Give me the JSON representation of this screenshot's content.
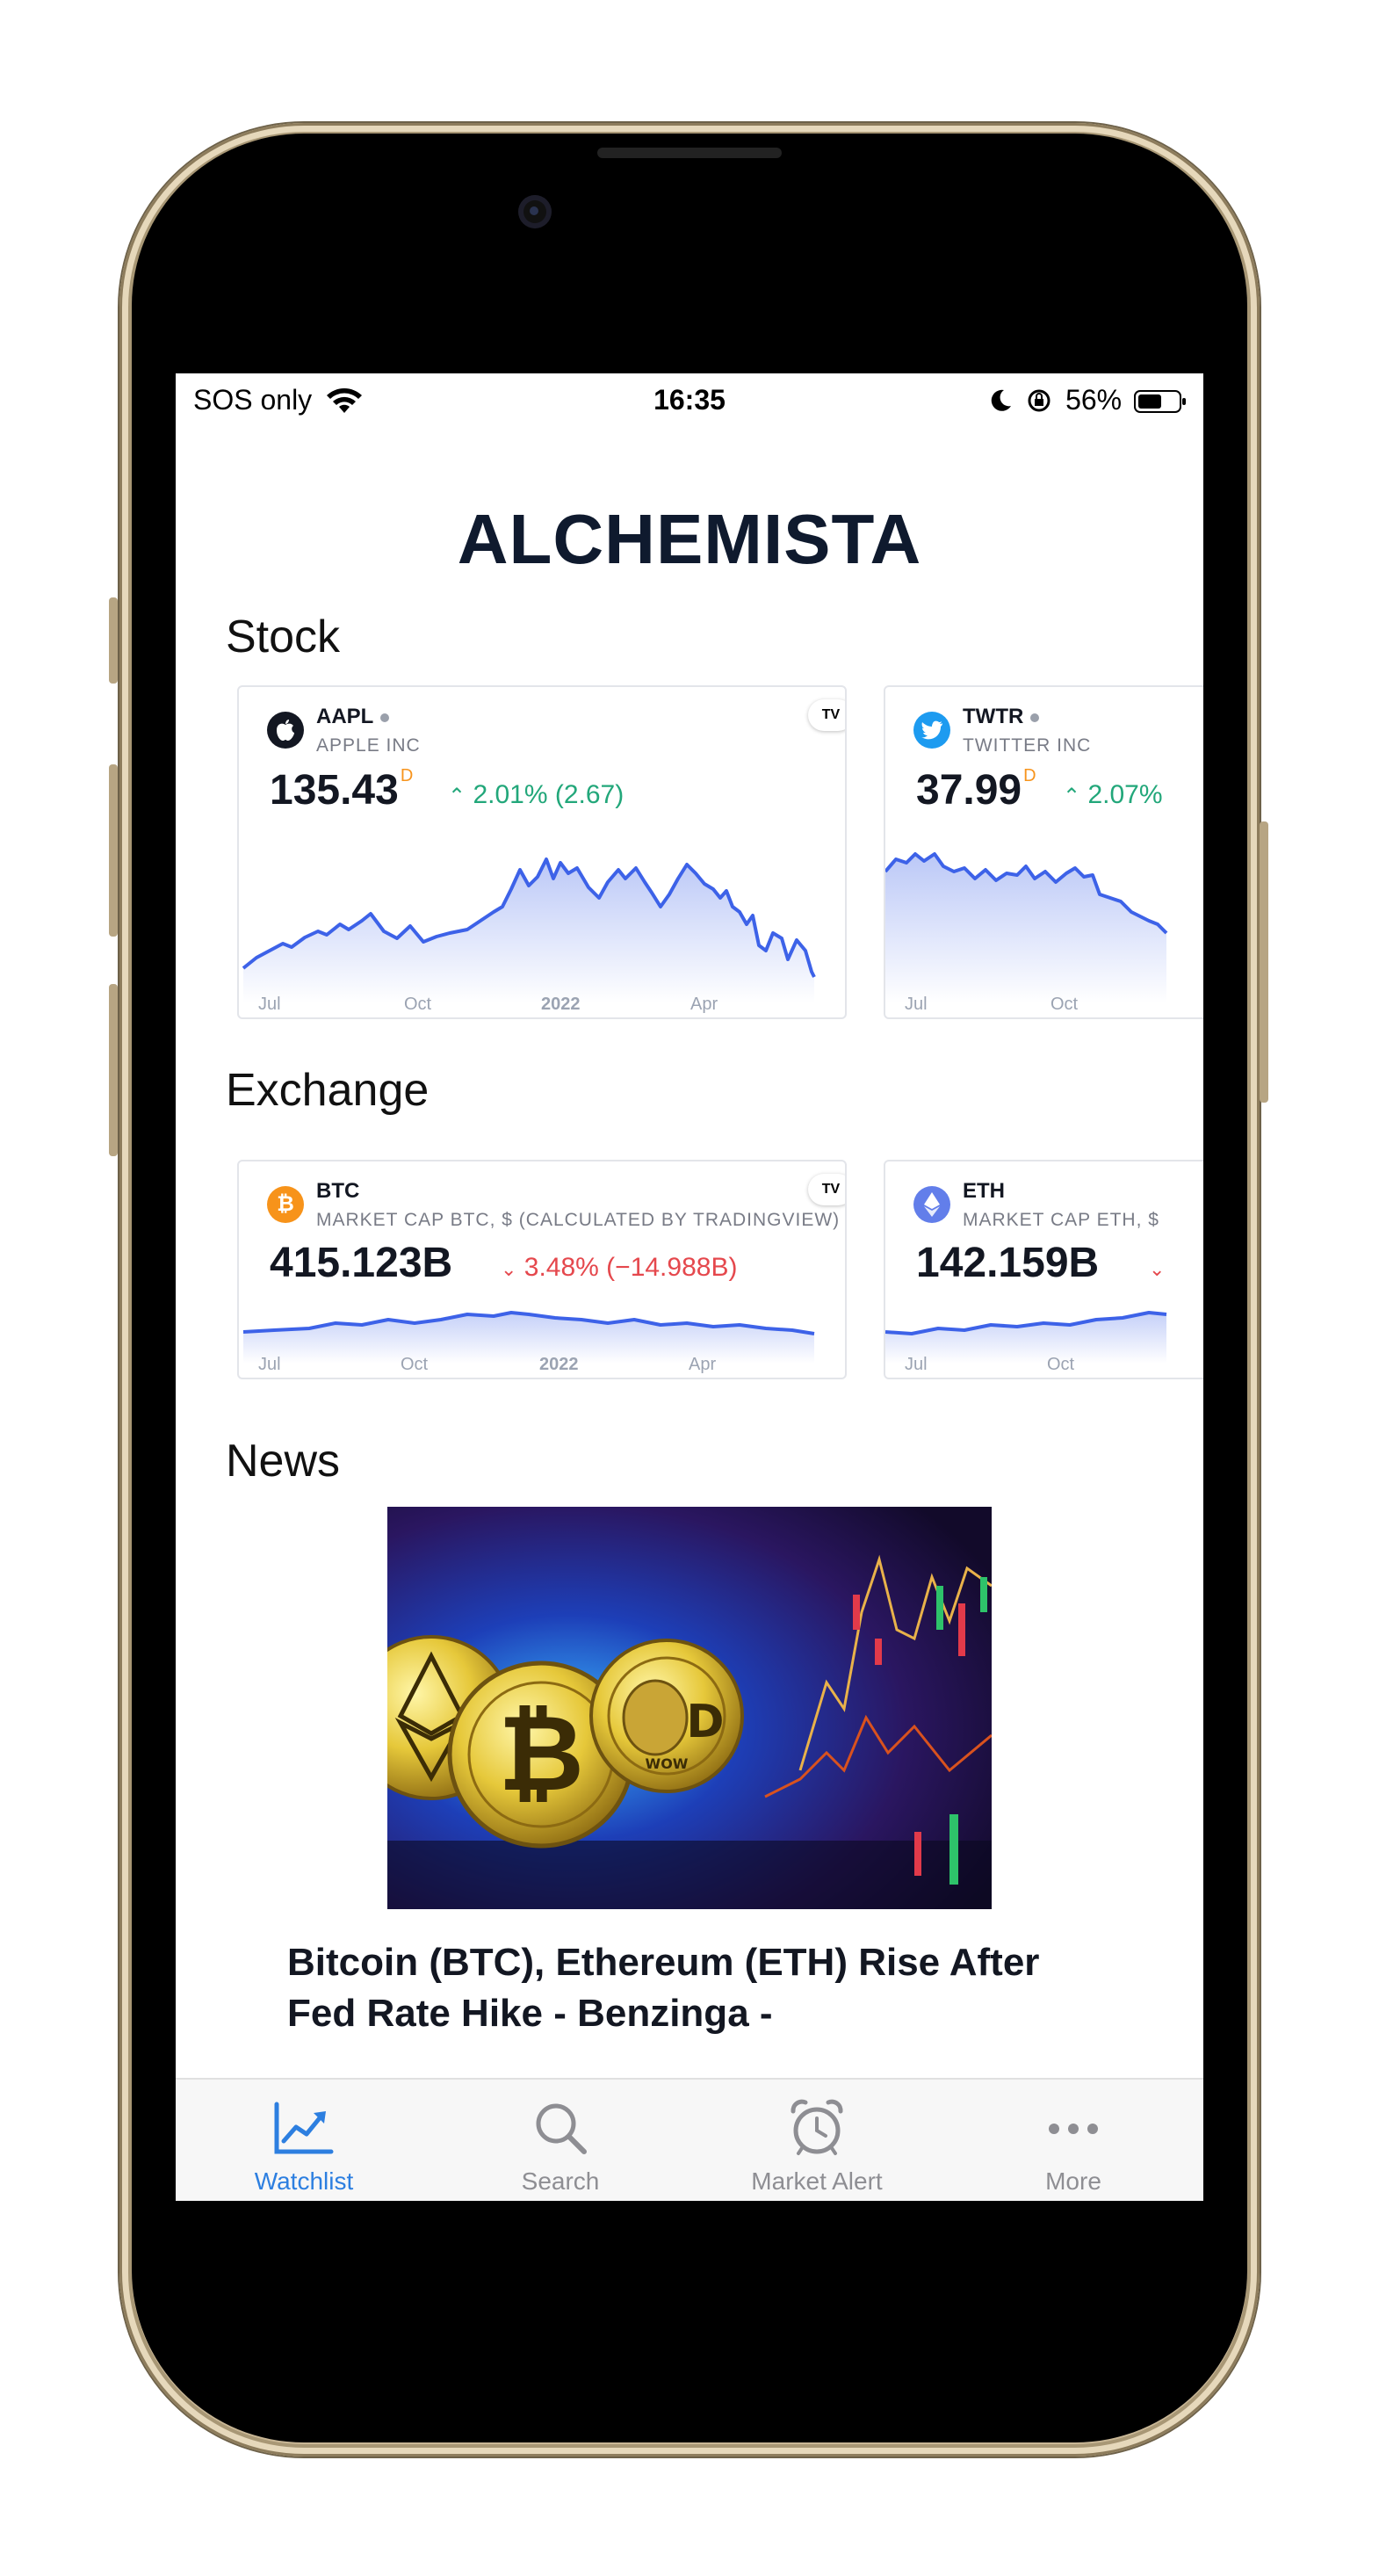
{
  "status_bar": {
    "carrier": "SOS only",
    "time": "16:35",
    "battery": "56%"
  },
  "app": {
    "title": "ALCHEMISTA"
  },
  "sections": {
    "stock": "Stock",
    "exchange": "Exchange",
    "news": "News"
  },
  "stock_cards": [
    {
      "symbol": "AAPL",
      "name": "APPLE INC",
      "price": "135.43",
      "flag": "D",
      "change": "2.01% (2.67)",
      "direction": "up",
      "x_labels": [
        "Jul",
        "Oct",
        "2022",
        "Apr"
      ],
      "logo": "apple-icon"
    },
    {
      "symbol": "TWTR",
      "name": "TWITTER INC",
      "price": "37.99",
      "flag": "D",
      "change": "2.07%",
      "direction": "up",
      "x_labels": [
        "Jul",
        "Oct"
      ],
      "logo": "twitter-bird-icon"
    }
  ],
  "exchange_cards": [
    {
      "symbol": "BTC",
      "name": "MARKET CAP BTC, $ (CALCULATED BY TRADINGVIEW)",
      "price": "415.123B",
      "change": "3.48% (−14.988B)",
      "direction": "down",
      "x_labels": [
        "Jul",
        "Oct",
        "2022",
        "Apr"
      ],
      "logo": "bitcoin-icon"
    },
    {
      "symbol": "ETH",
      "name": "MARKET CAP ETH, $",
      "price": "142.159B",
      "change": "",
      "direction": "down",
      "x_labels": [
        "Jul",
        "Oct"
      ],
      "logo": "ethereum-icon"
    }
  ],
  "tradingview_badge": "TV",
  "news": [
    {
      "headline": "Bitcoin (BTC), Ethereum (ETH) Rise After Fed Rate Hike - Benzinga -"
    }
  ],
  "tabs": [
    {
      "label": "Watchlist",
      "icon": "chart-line-icon",
      "active": true
    },
    {
      "label": "Search",
      "icon": "magnifier-icon",
      "active": false
    },
    {
      "label": "Market Alert",
      "icon": "alarm-clock-icon",
      "active": false
    },
    {
      "label": "More",
      "icon": "ellipsis-icon",
      "active": false
    }
  ],
  "colors": {
    "accent": "#2d7fe0",
    "up": "#22a77a",
    "down": "#e5484d",
    "line": "#3d62e8",
    "title": "#0f1a2e"
  }
}
